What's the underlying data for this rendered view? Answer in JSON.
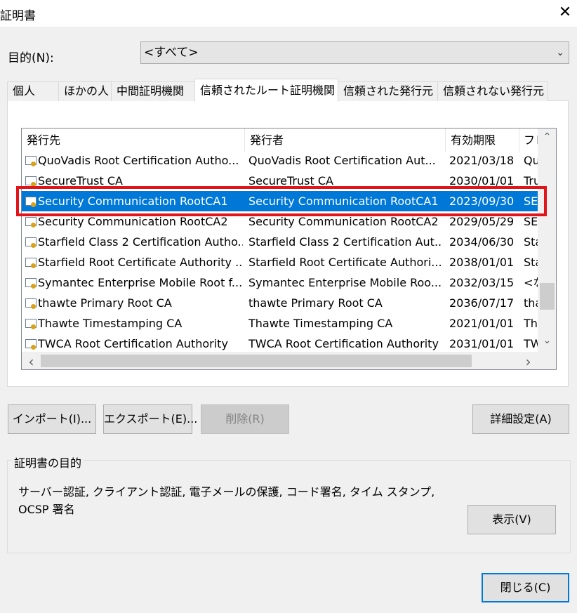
{
  "window": {
    "title": "証明書",
    "close_glyph": "✕"
  },
  "purpose": {
    "label": "目的(N):",
    "selected": "<すべて>"
  },
  "tabs": [
    {
      "label": "個人"
    },
    {
      "label": "ほかの人"
    },
    {
      "label": "中間証明機関"
    },
    {
      "label": "信頼されたルート証明機関"
    },
    {
      "label": "信頼された発行元"
    },
    {
      "label": "信頼されない発行元"
    }
  ],
  "active_tab_index": 3,
  "list": {
    "columns": [
      "発行先",
      "発行者",
      "有効期限",
      "フレ"
    ],
    "rows": [
      {
        "issued_to": "QuoVadis Root Certification Autho...",
        "issued_by": "QuoVadis Root Certification Aut...",
        "expires": "2021/03/18",
        "friendly": "Qu"
      },
      {
        "issued_to": "SecureTrust CA",
        "issued_by": "SecureTrust CA",
        "expires": "2030/01/01",
        "friendly": "Tru"
      },
      {
        "issued_to": "Security Communication RootCA1",
        "issued_by": "Security Communication RootCA1",
        "expires": "2023/09/30",
        "friendly": "SE"
      },
      {
        "issued_to": "Security Communication RootCA2",
        "issued_by": "Security Communication RootCA2",
        "expires": "2029/05/29",
        "friendly": "SE"
      },
      {
        "issued_to": "Starfield Class 2 Certification Autho...",
        "issued_by": "Starfield Class 2 Certification Aut...",
        "expires": "2034/06/30",
        "friendly": "Sta"
      },
      {
        "issued_to": "Starfield Root Certificate Authority ...",
        "issued_by": "Starfield Root Certificate Authori...",
        "expires": "2038/01/01",
        "friendly": "Sta"
      },
      {
        "issued_to": "Symantec Enterprise Mobile Root f...",
        "issued_by": "Symantec Enterprise Mobile Roo...",
        "expires": "2032/03/15",
        "friendly": "<な"
      },
      {
        "issued_to": "thawte Primary Root CA",
        "issued_by": "thawte Primary Root CA",
        "expires": "2036/07/17",
        "friendly": "tha"
      },
      {
        "issued_to": "Thawte Timestamping CA",
        "issued_by": "Thawte Timestamping CA",
        "expires": "2021/01/01",
        "friendly": "Th"
      },
      {
        "issued_to": "TWCA Root Certification Authority",
        "issued_by": "TWCA Root Certification Authority",
        "expires": "2031/01/01",
        "friendly": "TW"
      }
    ],
    "selected_index": 2,
    "scroll_arrows": {
      "up": "⌃",
      "down": "⌄",
      "left": "‹",
      "right": "›"
    }
  },
  "buttons": {
    "import": "インポート(I)...",
    "export": "エクスポート(E)...",
    "remove": "削除(R)",
    "advanced": "詳細設定(A)",
    "view": "表示(V)",
    "close": "閉じる(C)"
  },
  "cert_purpose": {
    "title": "証明書の目的",
    "text": "サーバー認証, クライアント認証, 電子メールの保護, コード署名, タイム スタンプ, OCSP 署名"
  },
  "colors": {
    "selection": "#0078d7",
    "highlight_box": "#e3131a"
  }
}
